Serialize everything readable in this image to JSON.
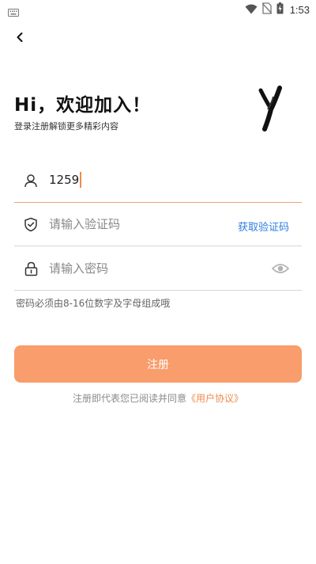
{
  "status_bar": {
    "time": "1:53"
  },
  "header": {
    "title": "Hi，欢迎加入！",
    "subtitle": "登录注册解锁更多精彩内容",
    "logo_text": "Y"
  },
  "form": {
    "account": {
      "value": "1259"
    },
    "code": {
      "placeholder": "请输入验证码",
      "action_label": "获取验证码"
    },
    "password": {
      "placeholder": "请输入密码"
    },
    "hint": "密码必须由8-16位数字及字母组成哦"
  },
  "submit": {
    "label": "注册"
  },
  "terms": {
    "prefix": "注册即代表您已阅读并同意",
    "link_label": "《用户协议》"
  },
  "colors": {
    "accent": "#f89d6b",
    "link": "#2f7de1",
    "active_underline": "#f4a37a"
  }
}
